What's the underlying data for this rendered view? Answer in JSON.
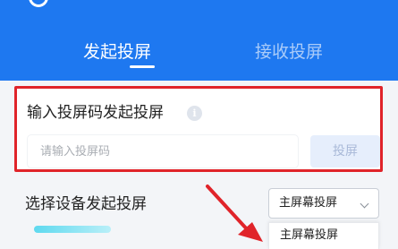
{
  "header": {
    "tabs": [
      {
        "label": "发起投屏",
        "active": true
      },
      {
        "label": "接收投屏",
        "active": false
      }
    ],
    "bg_color": "#1e78f0"
  },
  "code_panel": {
    "title": "输入投屏码发起投屏",
    "info_icon": "info-icon",
    "input_placeholder": "请输入投屏码",
    "input_value": "",
    "button_label": "投屏",
    "highlight_color": "#e0242a"
  },
  "device_section": {
    "label": "选择设备发起投屏",
    "select_value": "主屏幕投屏",
    "dropdown_options": [
      "主屏幕投屏"
    ]
  },
  "annotation": {
    "arrow_color": "#e0242a"
  }
}
